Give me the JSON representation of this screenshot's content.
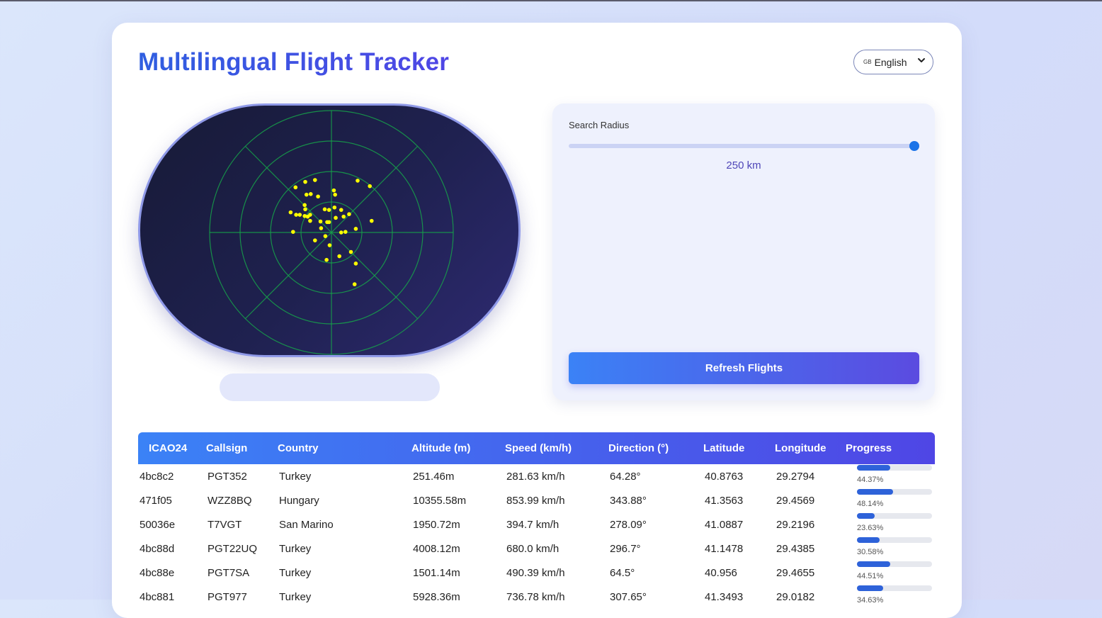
{
  "app": {
    "title": "Multilingual Flight Tracker",
    "language": {
      "flag": "GB",
      "selected": "English"
    }
  },
  "controls": {
    "radius_label": "Search Radius",
    "radius_value": 250,
    "radius_max": 250,
    "radius_text": "250 km",
    "refresh_label": "Refresh Flights"
  },
  "colors": {
    "accent": "#3b82f6",
    "accent_end": "#4f46e5",
    "radar_grid": "#16a34a",
    "aircraft_dot": "#ffff00",
    "progress_fill": "#2e62d9"
  },
  "table": {
    "headers": [
      "ICAO24",
      "Callsign",
      "Country",
      "Altitude (m)",
      "Speed (km/h)",
      "Direction (°)",
      "Latitude",
      "Longitude",
      "Progress"
    ],
    "rows": [
      {
        "icao24": "4bc8c2",
        "callsign": "PGT352",
        "country": "Turkey",
        "altitude": "251.46m",
        "speed": "281.63 km/h",
        "direction": "64.28°",
        "lat": "40.8763",
        "lon": "29.2794",
        "progress": 44.37,
        "progress_text": "44.37%"
      },
      {
        "icao24": "471f05",
        "callsign": "WZZ8BQ",
        "country": "Hungary",
        "altitude": "10355.58m",
        "speed": "853.99 km/h",
        "direction": "343.88°",
        "lat": "41.3563",
        "lon": "29.4569",
        "progress": 48.14,
        "progress_text": "48.14%"
      },
      {
        "icao24": "50036e",
        "callsign": "T7VGT",
        "country": "San Marino",
        "altitude": "1950.72m",
        "speed": "394.7 km/h",
        "direction": "278.09°",
        "lat": "41.0887",
        "lon": "29.2196",
        "progress": 23.63,
        "progress_text": "23.63%"
      },
      {
        "icao24": "4bc88d",
        "callsign": "PGT22UQ",
        "country": "Turkey",
        "altitude": "4008.12m",
        "speed": "680.0 km/h",
        "direction": "296.7°",
        "lat": "41.1478",
        "lon": "29.4385",
        "progress": 30.58,
        "progress_text": "30.58%"
      },
      {
        "icao24": "4bc88e",
        "callsign": "PGT7SA",
        "country": "Turkey",
        "altitude": "1501.14m",
        "speed": "490.39 km/h",
        "direction": "64.5°",
        "lat": "40.956",
        "lon": "29.4655",
        "progress": 44.51,
        "progress_text": "44.51%"
      },
      {
        "icao24": "4bc881",
        "callsign": "PGT977",
        "country": "Turkey",
        "altitude": "5928.36m",
        "speed": "736.78 km/h",
        "direction": "307.65°",
        "lat": "41.3493",
        "lon": "29.0182",
        "progress": 34.63,
        "progress_text": "34.63%"
      }
    ]
  },
  "radar": {
    "rings": 4,
    "spokes": 8,
    "aircraft": [
      [
        -0.43,
        -0.83
      ],
      [
        -0.27,
        -0.86
      ],
      [
        -0.59,
        -0.74
      ],
      [
        -0.41,
        -0.62
      ],
      [
        -0.34,
        -0.63
      ],
      [
        -0.22,
        -0.59
      ],
      [
        0.04,
        -0.69
      ],
      [
        0.06,
        -0.62
      ],
      [
        0.43,
        -0.85
      ],
      [
        0.63,
        -0.76
      ],
      [
        -0.44,
        -0.45
      ],
      [
        -0.43,
        -0.38
      ],
      [
        -0.67,
        -0.33
      ],
      [
        -0.58,
        -0.29
      ],
      [
        -0.52,
        -0.29
      ],
      [
        -0.44,
        -0.27
      ],
      [
        -0.39,
        -0.26
      ],
      [
        -0.35,
        -0.29
      ],
      [
        -0.11,
        -0.38
      ],
      [
        -0.04,
        -0.37
      ],
      [
        0.05,
        -0.41
      ],
      [
        0.16,
        -0.37
      ],
      [
        0.29,
        -0.3
      ],
      [
        0.2,
        -0.26
      ],
      [
        0.07,
        -0.24
      ],
      [
        -0.35,
        -0.19
      ],
      [
        -0.18,
        -0.18
      ],
      [
        -0.07,
        -0.17
      ],
      [
        -0.04,
        -0.17
      ],
      [
        -0.17,
        -0.07
      ],
      [
        0.4,
        -0.06
      ],
      [
        0.23,
        -0.01
      ],
      [
        0.16,
        0.0
      ],
      [
        0.66,
        -0.19
      ],
      [
        -0.63,
        -0.01
      ],
      [
        -0.1,
        0.06
      ],
      [
        -0.27,
        0.13
      ],
      [
        -0.03,
        0.21
      ],
      [
        0.13,
        0.39
      ],
      [
        -0.08,
        0.45
      ],
      [
        0.32,
        0.32
      ],
      [
        0.4,
        0.51
      ],
      [
        0.38,
        0.85
      ]
    ]
  }
}
